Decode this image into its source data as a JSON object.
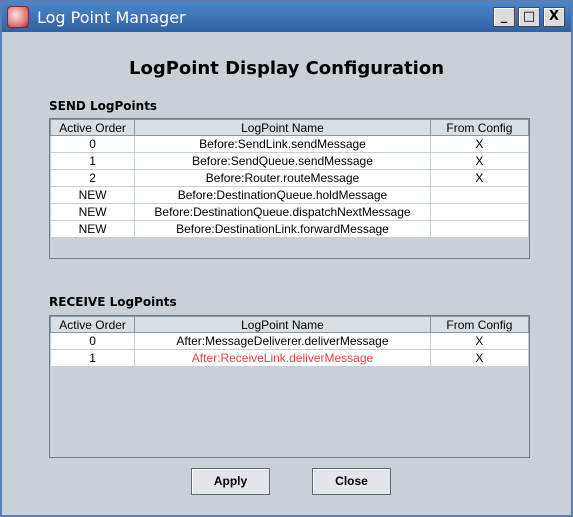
{
  "window": {
    "title": "Log Point Manager",
    "icon": "app-icon"
  },
  "window_controls": {
    "minimize": "_",
    "maximize": "□",
    "close": "X"
  },
  "heading": "LogPoint Display Configuration",
  "columns": {
    "order": "Active Order",
    "name": "LogPoint Name",
    "config": "From Config"
  },
  "send": {
    "label": "SEND LogPoints",
    "rows": [
      {
        "order": "0",
        "name": "Before:SendLink.sendMessage",
        "config": "X"
      },
      {
        "order": "1",
        "name": "Before:SendQueue.sendMessage",
        "config": "X"
      },
      {
        "order": "2",
        "name": "Before:Router.routeMessage",
        "config": "X"
      },
      {
        "order": "NEW",
        "name": "Before:DestinationQueue.holdMessage",
        "config": ""
      },
      {
        "order": "NEW",
        "name": "Before:DestinationQueue.dispatchNextMessage",
        "config": ""
      },
      {
        "order": "NEW",
        "name": "Before:DestinationLink.forwardMessage",
        "config": ""
      }
    ]
  },
  "receive": {
    "label": "RECEIVE LogPoints",
    "rows": [
      {
        "order": "0",
        "name": "After:MessageDeliverer.deliverMessage",
        "config": "X"
      },
      {
        "order": "1",
        "name": "After:ReceiveLink.deliverMessage",
        "config": "X"
      }
    ]
  },
  "buttons": {
    "apply": "Apply",
    "close": "Close"
  },
  "colors": {
    "title_bar": "#2f62a5",
    "highlight_text": "#e0443a",
    "window_bg": "#c9d0d6"
  }
}
